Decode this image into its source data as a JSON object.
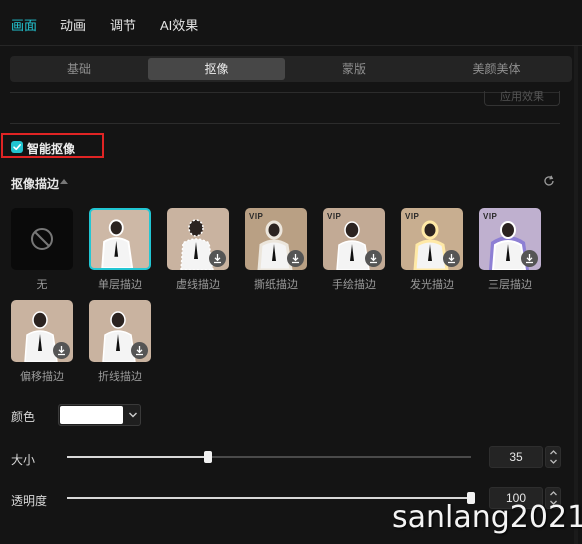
{
  "top_tabs": [
    {
      "label": "画面",
      "active": true
    },
    {
      "label": "动画",
      "active": false
    },
    {
      "label": "调节",
      "active": false
    },
    {
      "label": "AI效果",
      "active": false
    }
  ],
  "sub_tabs": [
    {
      "label": "基础",
      "active": false
    },
    {
      "label": "抠像",
      "active": true
    },
    {
      "label": "蒙版",
      "active": false
    },
    {
      "label": "美颜美体",
      "active": false
    }
  ],
  "apply_effect_label": "应用效果",
  "smart_cutout": {
    "label": "智能抠像",
    "checked": true
  },
  "outline_section": {
    "title": "抠像描边",
    "styles": [
      {
        "label": "无",
        "selected": false,
        "vip": false,
        "download": false,
        "icon": "none-icon"
      },
      {
        "label": "单层描边",
        "selected": true,
        "vip": false,
        "download": false
      },
      {
        "label": "虚线描边",
        "selected": false,
        "vip": false,
        "download": true
      },
      {
        "label": "撕纸描边",
        "selected": false,
        "vip": true,
        "download": true
      },
      {
        "label": "手绘描边",
        "selected": false,
        "vip": true,
        "download": true
      },
      {
        "label": "发光描边",
        "selected": false,
        "vip": true,
        "download": true
      },
      {
        "label": "三层描边",
        "selected": false,
        "vip": true,
        "download": true
      },
      {
        "label": "偏移描边",
        "selected": false,
        "vip": false,
        "download": true
      },
      {
        "label": "折线描边",
        "selected": false,
        "vip": false,
        "download": true
      }
    ],
    "vip_badge": "VIP"
  },
  "color": {
    "label": "颜色",
    "value": "#ffffff"
  },
  "size": {
    "label": "大小",
    "value": "35",
    "fraction": 0.35
  },
  "opacity": {
    "label": "透明度",
    "value": "100",
    "fraction": 1.0
  },
  "watermark": "sanlang2021",
  "colors": {
    "accent": "#22c6d3",
    "highlight_box": "#e02424"
  }
}
